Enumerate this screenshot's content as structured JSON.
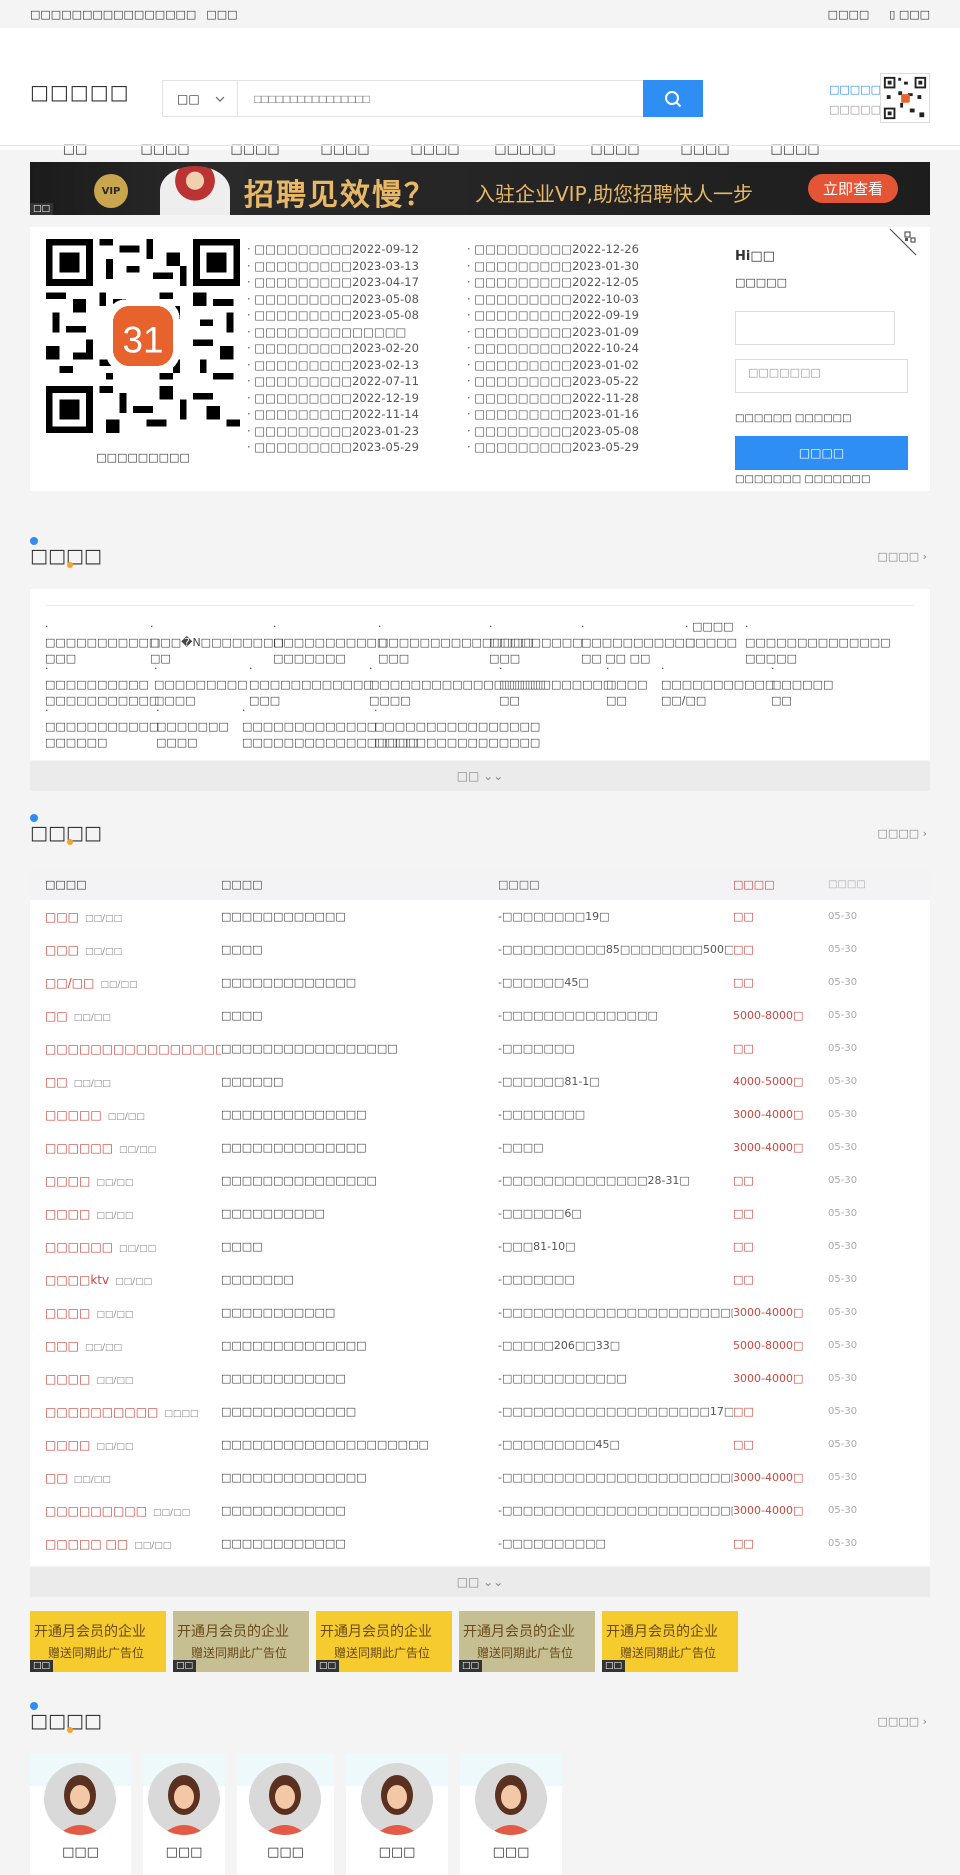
{
  "topbar": {
    "site": "□□□□□□□□□□□□□□□□",
    "login": "□□□",
    "user_center": "□□□□",
    "mobile": "□□□"
  },
  "header": {
    "logo": "□□□□□",
    "search_type": "□□",
    "search_placeholder": "□□□□□□□□□□□□□□□□",
    "link1": "□□□□□",
    "link2": "□□□□□□"
  },
  "nav": [
    "□□",
    "□□□□",
    "□□□□",
    "□□□□",
    "□□□□",
    "□□□□□",
    "□□□□",
    "□□□□",
    "□□□□"
  ],
  "banner": {
    "vip": "VIP",
    "headline": "招聘见效慢？",
    "sub": "入驻企业VIP,助您招聘快人一步",
    "button": "立即查看",
    "ad_tag": "□□"
  },
  "qr_caption": "□□□□□□□□□",
  "news_left": [
    "· □□□□□□□□□2022-09-12",
    "· □□□□□□□□□2023-03-13",
    "· □□□□□□□□□2023-04-17",
    "· □□□□□□□□□2023-05-08",
    "· □□□□□□□□□2023-05-08",
    "· □□□□□□□□□□□□□□",
    "· □□□□□□□□□2023-02-20",
    "· □□□□□□□□□2023-02-13",
    "· □□□□□□□□□2022-07-11",
    "· □□□□□□□□□2022-12-19",
    "· □□□□□□□□□2022-11-14",
    "· □□□□□□□□□2023-01-23",
    "· □□□□□□□□□2023-05-29"
  ],
  "news_right": [
    "· □□□□□□□□□2022-12-26",
    "· □□□□□□□□□2023-01-30",
    "· □□□□□□□□□2022-12-05",
    "· □□□□□□□□□2022-10-03",
    "· □□□□□□□□□2022-09-19",
    "· □□□□□□□□□2023-01-09",
    "· □□□□□□□□□2022-10-24",
    "· □□□□□□□□□2023-01-02",
    "· □□□□□□□□□2023-05-22",
    "· □□□□□□□□□2022-11-28",
    "· □□□□□□□□□2023-01-16",
    "· □□□□□□□□□2023-05-08",
    "· □□□□□□□□□2023-05-29"
  ],
  "login": {
    "hi": "Hi□□",
    "sub": "□□□□□",
    "password_placeholder": "□□□□□□□",
    "links": "□□□□□□ □□□□□□",
    "button": "□□□□",
    "bottom": "□□□□□□□ □□□□□□□"
  },
  "section1": {
    "title": "□□□□",
    "more": "□□□□ ›"
  },
  "tags_row1": [
    "· □□□□□□□□□□□\n□□□",
    "· □□□�N□□□□□□□□\n□□",
    "· □□□□□□□□□□□\n□□□□□□□",
    "· □□□□□□□□□□□□□□□\n□□□",
    "· □□□□□□□□□\n□□□",
    "· □□□□□□□□□□□\n□□ □□ □□",
    "· □□□□\n□□□□□",
    "· □□□□□□□□□□□□□□\n□□□□□"
  ],
  "tags_row2": [
    "· □□□□□□□□□□\n□□□□□□□□□□□",
    "· □□□□□□□□□\n□□□□",
    "· □□□□□□□□□□□□\n□□□",
    "· □□□□□□□□□□□□□□□□□\n□□□□",
    "· □□□□□□□□□□□\n□□",
    "· □□□□\n□□",
    "· □□□□□□□□□□□\n□□/□□",
    "· □□□□□□\n□□"
  ],
  "tags_row3": [
    "· □□□□□□□□□□□\n□□□□□□",
    "· □□□□□□□\n□□□□",
    "· □□□□□□□□□□□□□\n□□□□□□□□□□□□□□□□□",
    "· □□□□□□□□□□□□□□□□\n□□□□□□□□□□□□□□□□"
  ],
  "expand": "□□ ⌄⌄",
  "section2": {
    "title": "□□□□",
    "more": "□□□□ ›"
  },
  "job_headers": [
    "□□□□",
    "□□□□",
    "□□□□",
    "□□□□",
    "□□□□"
  ],
  "jobs": [
    {
      "title": "□□□",
      "sub": "□□/□□",
      "company": "□□□□□□□□□□□□",
      "addr": "-□□□□□□□□19□",
      "salary": "□□",
      "date": "05-30"
    },
    {
      "title": "□□□",
      "sub": "□□/□□",
      "company": "□□□□",
      "addr": "-□□□□□□□□□□85□□□□□□□□500□□",
      "salary": "□□",
      "date": "05-30"
    },
    {
      "title": "□□/□□",
      "sub": "□□/□□",
      "company": "□□□□□□□□□□□□□",
      "addr": "-□□□□□□45□",
      "salary": "□□",
      "date": "05-30"
    },
    {
      "title": "□□",
      "sub": "□□/□□",
      "company": "□□□□",
      "addr": "-□□□□□□□□□□□□□□□",
      "salary": "5000-8000□",
      "date": "05-30"
    },
    {
      "title": "□□□□□□□□□□□□□□□□□",
      "sub": "□□/□□",
      "company": "□□□□□□□□□□□□□□□□□",
      "addr": "-□□□□□□□",
      "salary": "□□",
      "date": "05-30"
    },
    {
      "title": "□□",
      "sub": "□□/□□",
      "company": "□□□□□□",
      "addr": "-□□□□□□81-1□",
      "salary": "4000-5000□",
      "date": "05-30"
    },
    {
      "title": "□□□□□",
      "sub": "□□/□□",
      "company": "□□□□□□□□□□□□□□",
      "addr": "-□□□□□□□□",
      "salary": "3000-4000□",
      "date": "05-30"
    },
    {
      "title": "□□□□□□",
      "sub": "□□/□□",
      "company": "□□□□□□□□□□□□□□",
      "addr": "-□□□□",
      "salary": "3000-4000□",
      "date": "05-30"
    },
    {
      "title": "□□□□",
      "sub": "□□/□□",
      "company": "□□□□□□□□□□□□□□□",
      "addr": "-□□□□□□□□□□□□□□28-31□",
      "salary": "□□",
      "date": "05-30"
    },
    {
      "title": "□□□□",
      "sub": "□□/□□",
      "company": "□□□□□□□□□□",
      "addr": "-□□□□□□6□",
      "salary": "□□",
      "date": "05-30"
    },
    {
      "title": "□□□□□□",
      "sub": "□□/□□",
      "company": "□□□□",
      "addr": "-□□□81-10□",
      "salary": "□□",
      "date": "05-30"
    },
    {
      "title": "□□□□ktv",
      "sub": "□□/□□",
      "company": "□□□□□□□",
      "addr": "-□□□□□□□",
      "salary": "□□",
      "date": "05-30"
    },
    {
      "title": "□□□□",
      "sub": "□□/□□",
      "company": "□□□□□□□□□□□",
      "addr": "-□□□□□□□□□□□□□□□□□□□□□□□□□",
      "salary": "3000-4000□",
      "date": "05-30"
    },
    {
      "title": "□□□",
      "sub": "□□/□□",
      "company": "□□□□□□□□□□□□□□",
      "addr": "-□□□□□206□□33□",
      "salary": "5000-8000□",
      "date": "05-30"
    },
    {
      "title": "□□□□",
      "sub": "□□/□□",
      "company": "□□□□□□□□□□□□",
      "addr": "-□□□□□□□□□□□□",
      "salary": "3000-4000□",
      "date": "05-30"
    },
    {
      "title": "□□□□□□□□□□",
      "sub": "□□□□",
      "company": "□□□□□□□□□□□□□",
      "addr": "-□□□□□□□□□□□□□□□□□□□□17□",
      "salary": "□□",
      "date": "05-30"
    },
    {
      "title": "□□□□",
      "sub": "□□/□□",
      "company": "□□□□□□□□□□□□□□□□□□□□",
      "addr": "-□□□□□□□□□45□",
      "salary": "□□",
      "date": "05-30"
    },
    {
      "title": "□□",
      "sub": "□□/□□",
      "company": "□□□□□□□□□□□□□□",
      "addr": "-□□□□□□□□□□□□□□□□□□□□□□□□",
      "salary": "3000-4000□",
      "date": "05-30"
    },
    {
      "title": "□□□□□□□□□",
      "sub": "□□/□□",
      "company": "□□□□□□□□□□□□",
      "addr": "-□□□□□□□□□□□□□□□□□□□□□□□□",
      "salary": "3000-4000□",
      "date": "05-30"
    },
    {
      "title": "□□□□□ □□",
      "sub": "□□/□□",
      "company": "□□□□□□□□□□□□",
      "addr": "-□□□□□□□□□□",
      "salary": "□□",
      "date": "05-30"
    }
  ],
  "ad_slots": {
    "line1": "开通月会员的企业",
    "line2": "赠送同期此广告位",
    "tag": "□□"
  },
  "section3": {
    "title": "□□□□",
    "more": "□□□□ ›"
  },
  "people": [
    "□□□",
    "□□□",
    "□□□",
    "□□□",
    "□□□"
  ]
}
